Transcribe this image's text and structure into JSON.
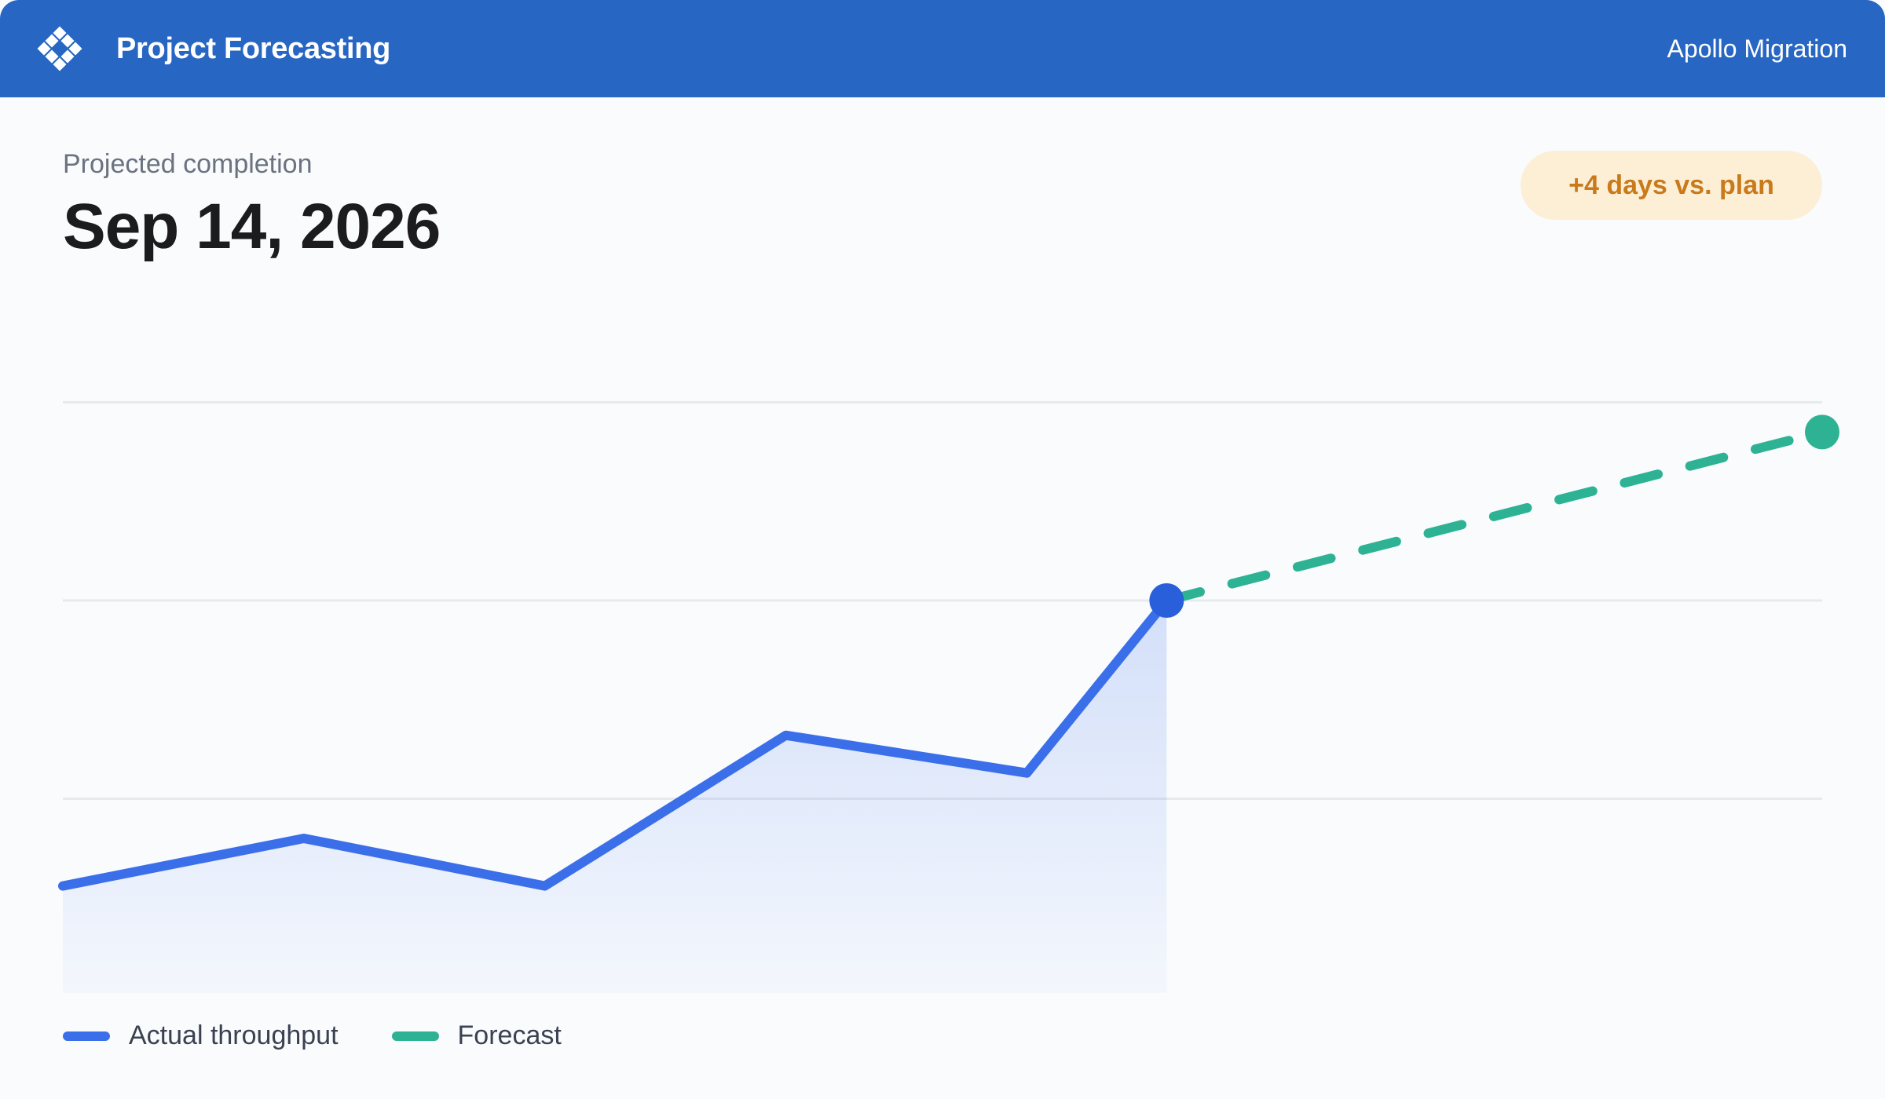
{
  "header": {
    "app_title": "Project Forecasting",
    "project_name": "Apollo Migration",
    "logo_icon": "diamond-grid-logo-icon",
    "background_color": "#2766c2"
  },
  "summary": {
    "label": "Projected completion",
    "date": "Sep 14, 2026",
    "badge": "+4 days vs. plan",
    "badge_color": "#c97a1a",
    "badge_background": "#fdefd5"
  },
  "chart_data": {
    "type": "line",
    "title": "",
    "xlabel": "",
    "ylabel": "",
    "ylim": [
      0,
      4
    ],
    "grid": true,
    "series": [
      {
        "name": "Actual throughput",
        "color": "#3b6fea",
        "style": "solid",
        "area_fill": true,
        "x": [
          0,
          1,
          2,
          3,
          4,
          4.58
        ],
        "values": [
          0.56,
          0.8,
          0.56,
          1.32,
          1.13,
          2.0
        ]
      },
      {
        "name": "Forecast",
        "color": "#2db394",
        "style": "dashed",
        "x": [
          4.58,
          7.3
        ],
        "values": [
          2.0,
          2.85
        ]
      }
    ],
    "xlim": [
      0,
      7.3
    ],
    "legend": {
      "placement": "bottom-left",
      "items": [
        {
          "label": "Actual throughput",
          "color": "#3b6fea"
        },
        {
          "label": "Forecast",
          "color": "#2db394"
        }
      ]
    }
  }
}
